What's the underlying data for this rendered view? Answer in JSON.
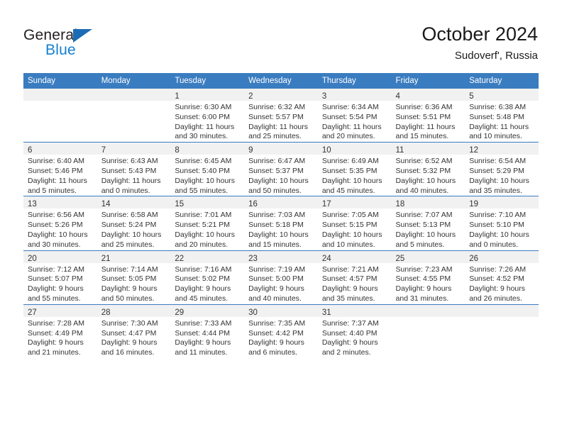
{
  "logo": {
    "word_top": "General",
    "word_bottom": "Blue",
    "flag_icon": "triangle-flag-icon",
    "brand_color": "#137fd1"
  },
  "header": {
    "title": "October 2024",
    "subtitle": "Sudoverf', Russia"
  },
  "theme": {
    "header_blue": "#3a7cc0",
    "daynum_band": "#f1f1f1",
    "text": "#333333"
  },
  "weekdays": [
    "Sunday",
    "Monday",
    "Tuesday",
    "Wednesday",
    "Thursday",
    "Friday",
    "Saturday"
  ],
  "weeks": [
    [
      {
        "day": "",
        "lines": []
      },
      {
        "day": "",
        "lines": []
      },
      {
        "day": "1",
        "lines": [
          "Sunrise: 6:30 AM",
          "Sunset: 6:00 PM",
          "Daylight: 11 hours",
          "and 30 minutes."
        ]
      },
      {
        "day": "2",
        "lines": [
          "Sunrise: 6:32 AM",
          "Sunset: 5:57 PM",
          "Daylight: 11 hours",
          "and 25 minutes."
        ]
      },
      {
        "day": "3",
        "lines": [
          "Sunrise: 6:34 AM",
          "Sunset: 5:54 PM",
          "Daylight: 11 hours",
          "and 20 minutes."
        ]
      },
      {
        "day": "4",
        "lines": [
          "Sunrise: 6:36 AM",
          "Sunset: 5:51 PM",
          "Daylight: 11 hours",
          "and 15 minutes."
        ]
      },
      {
        "day": "5",
        "lines": [
          "Sunrise: 6:38 AM",
          "Sunset: 5:48 PM",
          "Daylight: 11 hours",
          "and 10 minutes."
        ]
      }
    ],
    [
      {
        "day": "6",
        "lines": [
          "Sunrise: 6:40 AM",
          "Sunset: 5:46 PM",
          "Daylight: 11 hours",
          "and 5 minutes."
        ]
      },
      {
        "day": "7",
        "lines": [
          "Sunrise: 6:43 AM",
          "Sunset: 5:43 PM",
          "Daylight: 11 hours",
          "and 0 minutes."
        ]
      },
      {
        "day": "8",
        "lines": [
          "Sunrise: 6:45 AM",
          "Sunset: 5:40 PM",
          "Daylight: 10 hours",
          "and 55 minutes."
        ]
      },
      {
        "day": "9",
        "lines": [
          "Sunrise: 6:47 AM",
          "Sunset: 5:37 PM",
          "Daylight: 10 hours",
          "and 50 minutes."
        ]
      },
      {
        "day": "10",
        "lines": [
          "Sunrise: 6:49 AM",
          "Sunset: 5:35 PM",
          "Daylight: 10 hours",
          "and 45 minutes."
        ]
      },
      {
        "day": "11",
        "lines": [
          "Sunrise: 6:52 AM",
          "Sunset: 5:32 PM",
          "Daylight: 10 hours",
          "and 40 minutes."
        ]
      },
      {
        "day": "12",
        "lines": [
          "Sunrise: 6:54 AM",
          "Sunset: 5:29 PM",
          "Daylight: 10 hours",
          "and 35 minutes."
        ]
      }
    ],
    [
      {
        "day": "13",
        "lines": [
          "Sunrise: 6:56 AM",
          "Sunset: 5:26 PM",
          "Daylight: 10 hours",
          "and 30 minutes."
        ]
      },
      {
        "day": "14",
        "lines": [
          "Sunrise: 6:58 AM",
          "Sunset: 5:24 PM",
          "Daylight: 10 hours",
          "and 25 minutes."
        ]
      },
      {
        "day": "15",
        "lines": [
          "Sunrise: 7:01 AM",
          "Sunset: 5:21 PM",
          "Daylight: 10 hours",
          "and 20 minutes."
        ]
      },
      {
        "day": "16",
        "lines": [
          "Sunrise: 7:03 AM",
          "Sunset: 5:18 PM",
          "Daylight: 10 hours",
          "and 15 minutes."
        ]
      },
      {
        "day": "17",
        "lines": [
          "Sunrise: 7:05 AM",
          "Sunset: 5:15 PM",
          "Daylight: 10 hours",
          "and 10 minutes."
        ]
      },
      {
        "day": "18",
        "lines": [
          "Sunrise: 7:07 AM",
          "Sunset: 5:13 PM",
          "Daylight: 10 hours",
          "and 5 minutes."
        ]
      },
      {
        "day": "19",
        "lines": [
          "Sunrise: 7:10 AM",
          "Sunset: 5:10 PM",
          "Daylight: 10 hours",
          "and 0 minutes."
        ]
      }
    ],
    [
      {
        "day": "20",
        "lines": [
          "Sunrise: 7:12 AM",
          "Sunset: 5:07 PM",
          "Daylight: 9 hours",
          "and 55 minutes."
        ]
      },
      {
        "day": "21",
        "lines": [
          "Sunrise: 7:14 AM",
          "Sunset: 5:05 PM",
          "Daylight: 9 hours",
          "and 50 minutes."
        ]
      },
      {
        "day": "22",
        "lines": [
          "Sunrise: 7:16 AM",
          "Sunset: 5:02 PM",
          "Daylight: 9 hours",
          "and 45 minutes."
        ]
      },
      {
        "day": "23",
        "lines": [
          "Sunrise: 7:19 AM",
          "Sunset: 5:00 PM",
          "Daylight: 9 hours",
          "and 40 minutes."
        ]
      },
      {
        "day": "24",
        "lines": [
          "Sunrise: 7:21 AM",
          "Sunset: 4:57 PM",
          "Daylight: 9 hours",
          "and 35 minutes."
        ]
      },
      {
        "day": "25",
        "lines": [
          "Sunrise: 7:23 AM",
          "Sunset: 4:55 PM",
          "Daylight: 9 hours",
          "and 31 minutes."
        ]
      },
      {
        "day": "26",
        "lines": [
          "Sunrise: 7:26 AM",
          "Sunset: 4:52 PM",
          "Daylight: 9 hours",
          "and 26 minutes."
        ]
      }
    ],
    [
      {
        "day": "27",
        "lines": [
          "Sunrise: 7:28 AM",
          "Sunset: 4:49 PM",
          "Daylight: 9 hours",
          "and 21 minutes."
        ]
      },
      {
        "day": "28",
        "lines": [
          "Sunrise: 7:30 AM",
          "Sunset: 4:47 PM",
          "Daylight: 9 hours",
          "and 16 minutes."
        ]
      },
      {
        "day": "29",
        "lines": [
          "Sunrise: 7:33 AM",
          "Sunset: 4:44 PM",
          "Daylight: 9 hours",
          "and 11 minutes."
        ]
      },
      {
        "day": "30",
        "lines": [
          "Sunrise: 7:35 AM",
          "Sunset: 4:42 PM",
          "Daylight: 9 hours",
          "and 6 minutes."
        ]
      },
      {
        "day": "31",
        "lines": [
          "Sunrise: 7:37 AM",
          "Sunset: 4:40 PM",
          "Daylight: 9 hours",
          "and 2 minutes."
        ]
      },
      {
        "day": "",
        "lines": []
      },
      {
        "day": "",
        "lines": []
      }
    ]
  ]
}
